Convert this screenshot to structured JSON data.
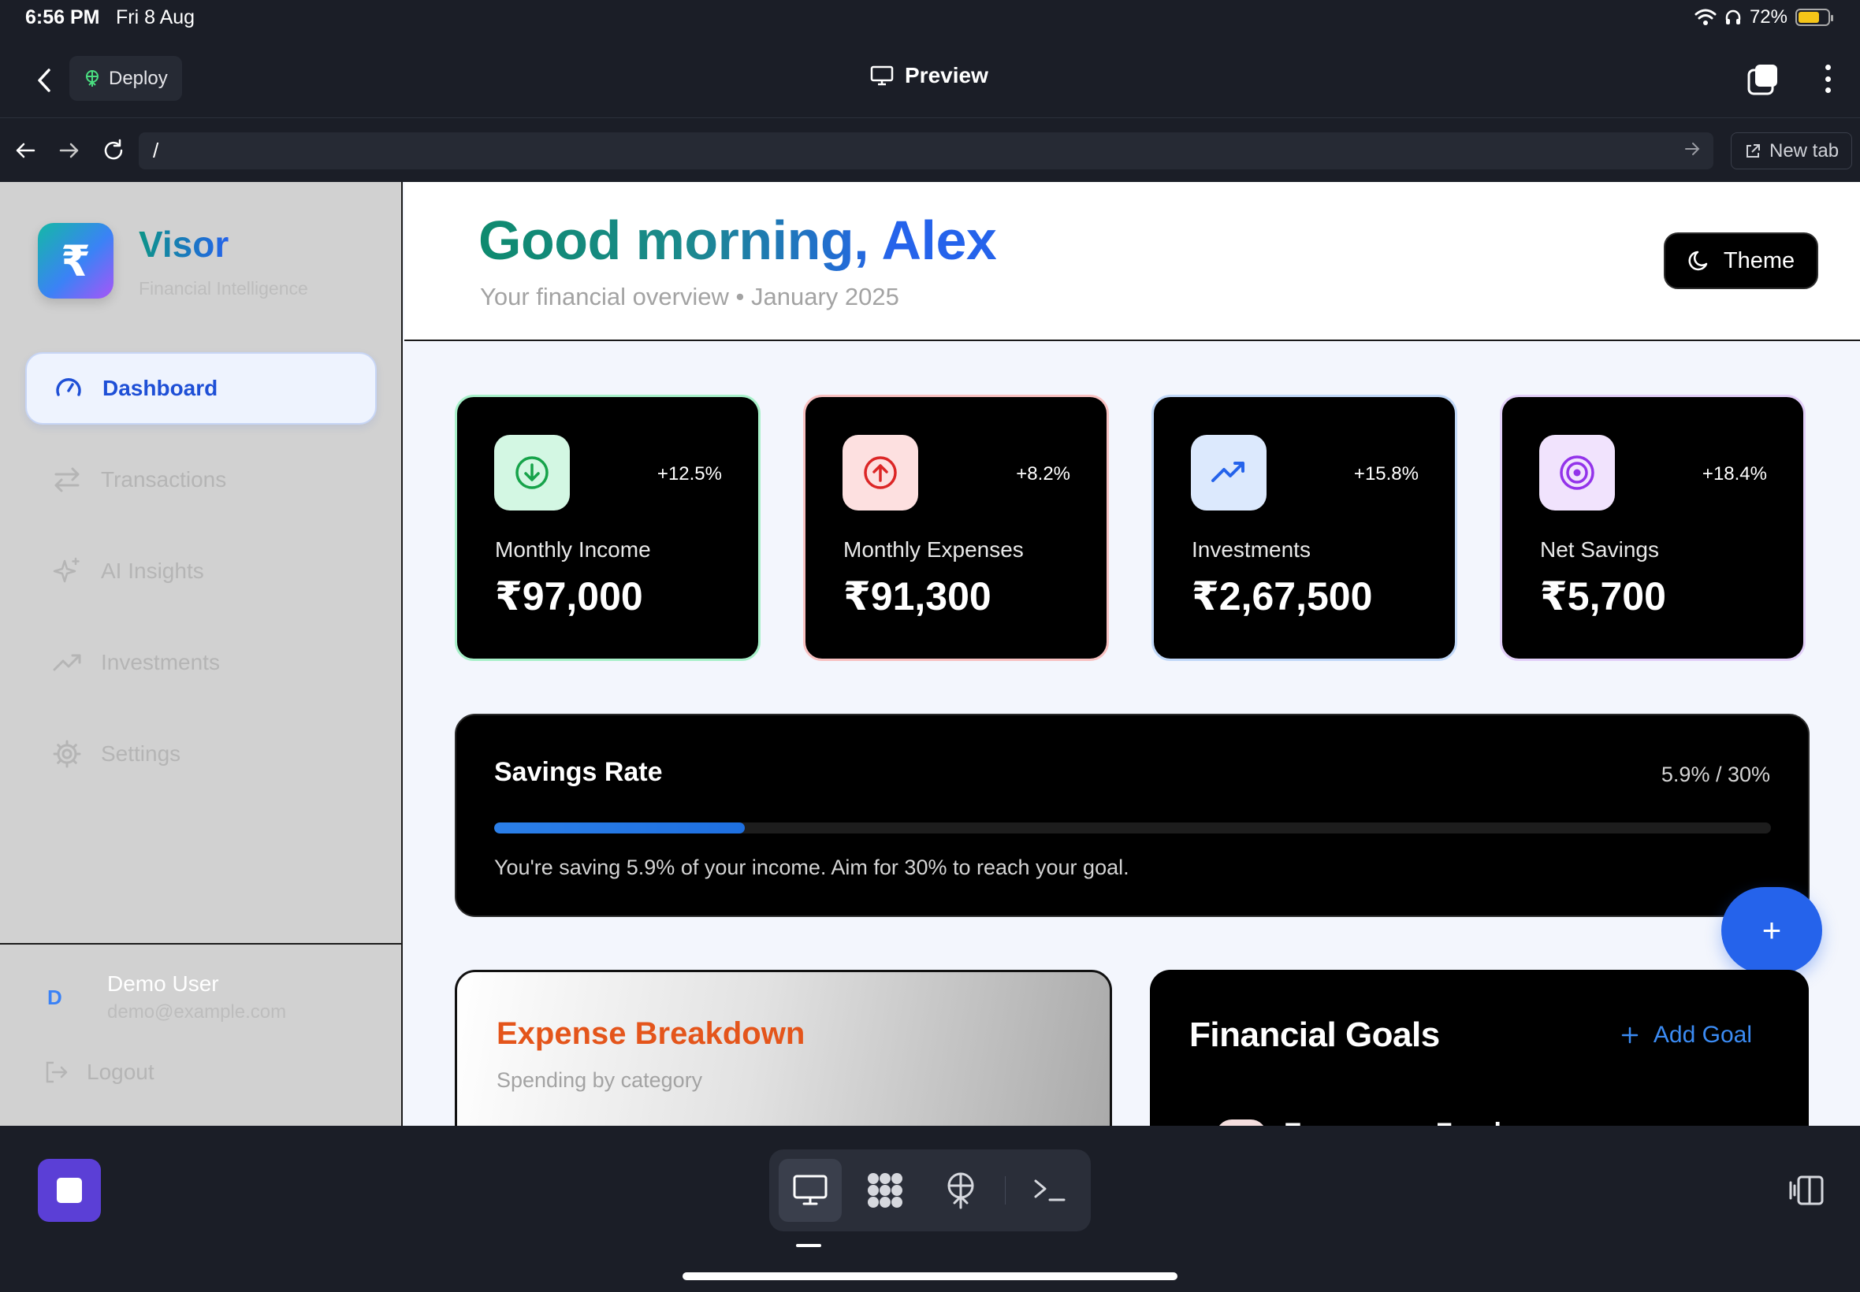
{
  "status_bar": {
    "time": "6:56 PM",
    "date": "Fri 8 Aug",
    "battery": "72%"
  },
  "app_bar": {
    "deploy_label": "Deploy",
    "preview_label": "Preview"
  },
  "url_bar": {
    "url": "/",
    "new_tab_label": "New tab"
  },
  "sidebar": {
    "brand_symbol": "₹",
    "brand_name": "Visor",
    "brand_subtitle": "Financial Intelligence",
    "items": [
      {
        "label": "Dashboard",
        "icon": "gauge-icon",
        "active": true
      },
      {
        "label": "Transactions",
        "icon": "arrows-swap-icon",
        "active": false
      },
      {
        "label": "AI Insights",
        "icon": "sparkles-icon",
        "active": false
      },
      {
        "label": "Investments",
        "icon": "trending-up-icon",
        "active": false
      },
      {
        "label": "Settings",
        "icon": "gear-icon",
        "active": false
      }
    ],
    "user": {
      "initial": "D",
      "name": "Demo User",
      "email": "demo@example.com"
    },
    "logout_label": "Logout"
  },
  "header": {
    "greeting": "Good morning, Alex",
    "subtitle": "Your financial overview • January 2025",
    "theme_label": "Theme"
  },
  "stats": [
    {
      "label": "Monthly Income",
      "value": "₹97,000",
      "change": "+12.5%",
      "icon": "arrow-down-circle-icon",
      "color": "#16a34a"
    },
    {
      "label": "Monthly Expenses",
      "value": "₹91,300",
      "change": "+8.2%",
      "icon": "arrow-up-circle-icon",
      "color": "#dc2626"
    },
    {
      "label": "Investments",
      "value": "₹2,67,500",
      "change": "+15.8%",
      "icon": "trending-up-icon",
      "color": "#2563eb"
    },
    {
      "label": "Net Savings",
      "value": "₹5,700",
      "change": "+18.4%",
      "icon": "target-icon",
      "color": "#9333ea"
    }
  ],
  "savings_rate": {
    "title": "Savings Rate",
    "ratio": "5.9% / 30%",
    "progress_fraction": 0.196,
    "note": "You're saving 5.9% of your income. Aim for 30% to reach your goal."
  },
  "fab_label": "+",
  "expense_breakdown": {
    "title": "Expense Breakdown",
    "subtitle": "Spending by category"
  },
  "financial_goals": {
    "title": "Financial Goals",
    "add_label": "Add Goal",
    "first_item_partial": "Emergency Fund"
  },
  "colors": {
    "accent_blue": "#2563eb",
    "income_green": "#16a34a",
    "expense_red": "#dc2626",
    "savings_purple": "#9333ea",
    "expense_orange": "#e4551b"
  }
}
